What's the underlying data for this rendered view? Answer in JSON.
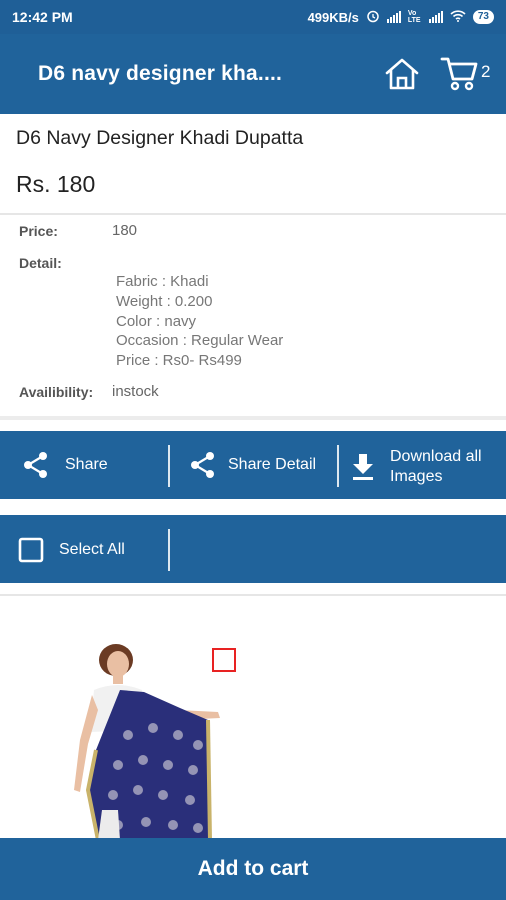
{
  "status_bar": {
    "time": "12:42 PM",
    "network_speed": "499KB/s",
    "volte": "Vo LTE",
    "battery": "73",
    "icons": [
      "alarm-icon",
      "signal-icon",
      "wifi-icon",
      "battery-icon"
    ]
  },
  "app_bar": {
    "title": "D6 navy designer kha....",
    "cart_count": "2",
    "icons": [
      "home-icon",
      "cart-icon"
    ]
  },
  "product": {
    "title": "D6 Navy Designer Khadi Dupatta",
    "price_display": "Rs. 180",
    "price_label": "Price:",
    "price_value": "180",
    "detail_label": "Detail:",
    "detail_lines": [
      "Fabric : Khadi",
      "Weight : 0.200",
      "Color : navy",
      "Occasion : Regular Wear",
      "Price : Rs0- Rs499"
    ],
    "availability_label": "Availibility:",
    "availability_value": "instock"
  },
  "actions": {
    "share": "Share",
    "share_detail": "Share Detail",
    "download_line1": "Download all",
    "download_line2": "Images",
    "select_all": "Select All"
  },
  "footer": {
    "add_to_cart": "Add to cart"
  },
  "colors": {
    "primary": "#20639b",
    "status_bar": "#1f5f97",
    "checkbox_red": "#e82222",
    "dupatta_navy": "#2a2f7a"
  }
}
